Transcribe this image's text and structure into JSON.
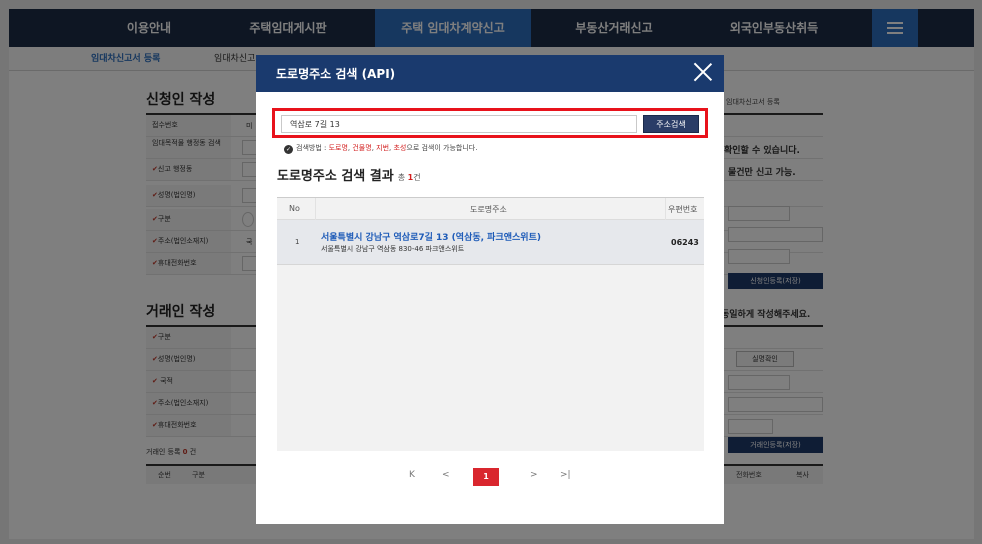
{
  "gnb": {
    "items": [
      "이용안내",
      "주택임대게시판",
      "주택 임대차계약신고",
      "부동산거래신고",
      "외국인부동산취득"
    ],
    "active_index": 2
  },
  "subnav": {
    "items": [
      "임대차신고서 등록",
      "임대차신고"
    ]
  },
  "applicant_section": {
    "title": "신청인 작성",
    "breadcrumb": "› 임대차신고서 등록",
    "labels": [
      "접수번호",
      "임대목적물 행정동 검색",
      "신고 행정동",
      "성명(법인명)",
      "구분",
      "주소(법인소재지)",
      "휴대전화번호"
    ],
    "label_values": [
      "미",
      "",
      "",
      "",
      "",
      "국",
      ""
    ],
    "right_text_1": "확인할 수 있습니다.",
    "right_text_2": "물건만 신고 가능.",
    "save_button": "신청인등록(저장)"
  },
  "counterparty_section": {
    "title": "거래인 작성",
    "right_text": "동일하게 작성해주세요.",
    "labels": [
      "구분",
      "성명(법인명)",
      "국적",
      "주소(법인소재지)",
      "휴대전화번호"
    ],
    "verify_button": "실명확인",
    "count_label": "거래인 등록",
    "count": "0",
    "count_unit": "건",
    "save_button": "거래인등록(저장)",
    "table_headers": [
      "순번",
      "구분",
      "전화번호",
      "복사"
    ]
  },
  "modal": {
    "title": "도로명주소 검색 (API)",
    "search": {
      "value": "역삼로 7길 13",
      "button_label": "주소검색"
    },
    "hint": {
      "prefix": "검색방법 : ",
      "keywords": [
        "도로명",
        "건물명",
        "지번",
        "초성"
      ],
      "suffix": "으로 검색이 가능합니다."
    },
    "results": {
      "heading": "도로명주소 검색 결과",
      "total_label": "총",
      "total": "1",
      "unit": "건",
      "columns": [
        "No",
        "도로명주소",
        "우편번호"
      ],
      "rows": [
        {
          "no": "1",
          "road_address": "서울특별시 강남구 역삼로7길 13 (역삼동, 파크앤스위트)",
          "jibun_address": "서울특별시 강남구 역삼동 830-46 파크앤스위트",
          "zip": "06243"
        }
      ]
    },
    "pagination": {
      "first": "K",
      "prev": "<",
      "current": "1",
      "next": ">",
      "last": ">|"
    }
  },
  "colors": {
    "nav_bg": "#1c2c46",
    "nav_active": "#2c6fbf",
    "modal_header": "#1a3a6e",
    "search_button": "#2a3d67",
    "highlight_border": "#e8121b",
    "link_blue": "#1e5bb8",
    "accent_red": "#d9262e"
  }
}
